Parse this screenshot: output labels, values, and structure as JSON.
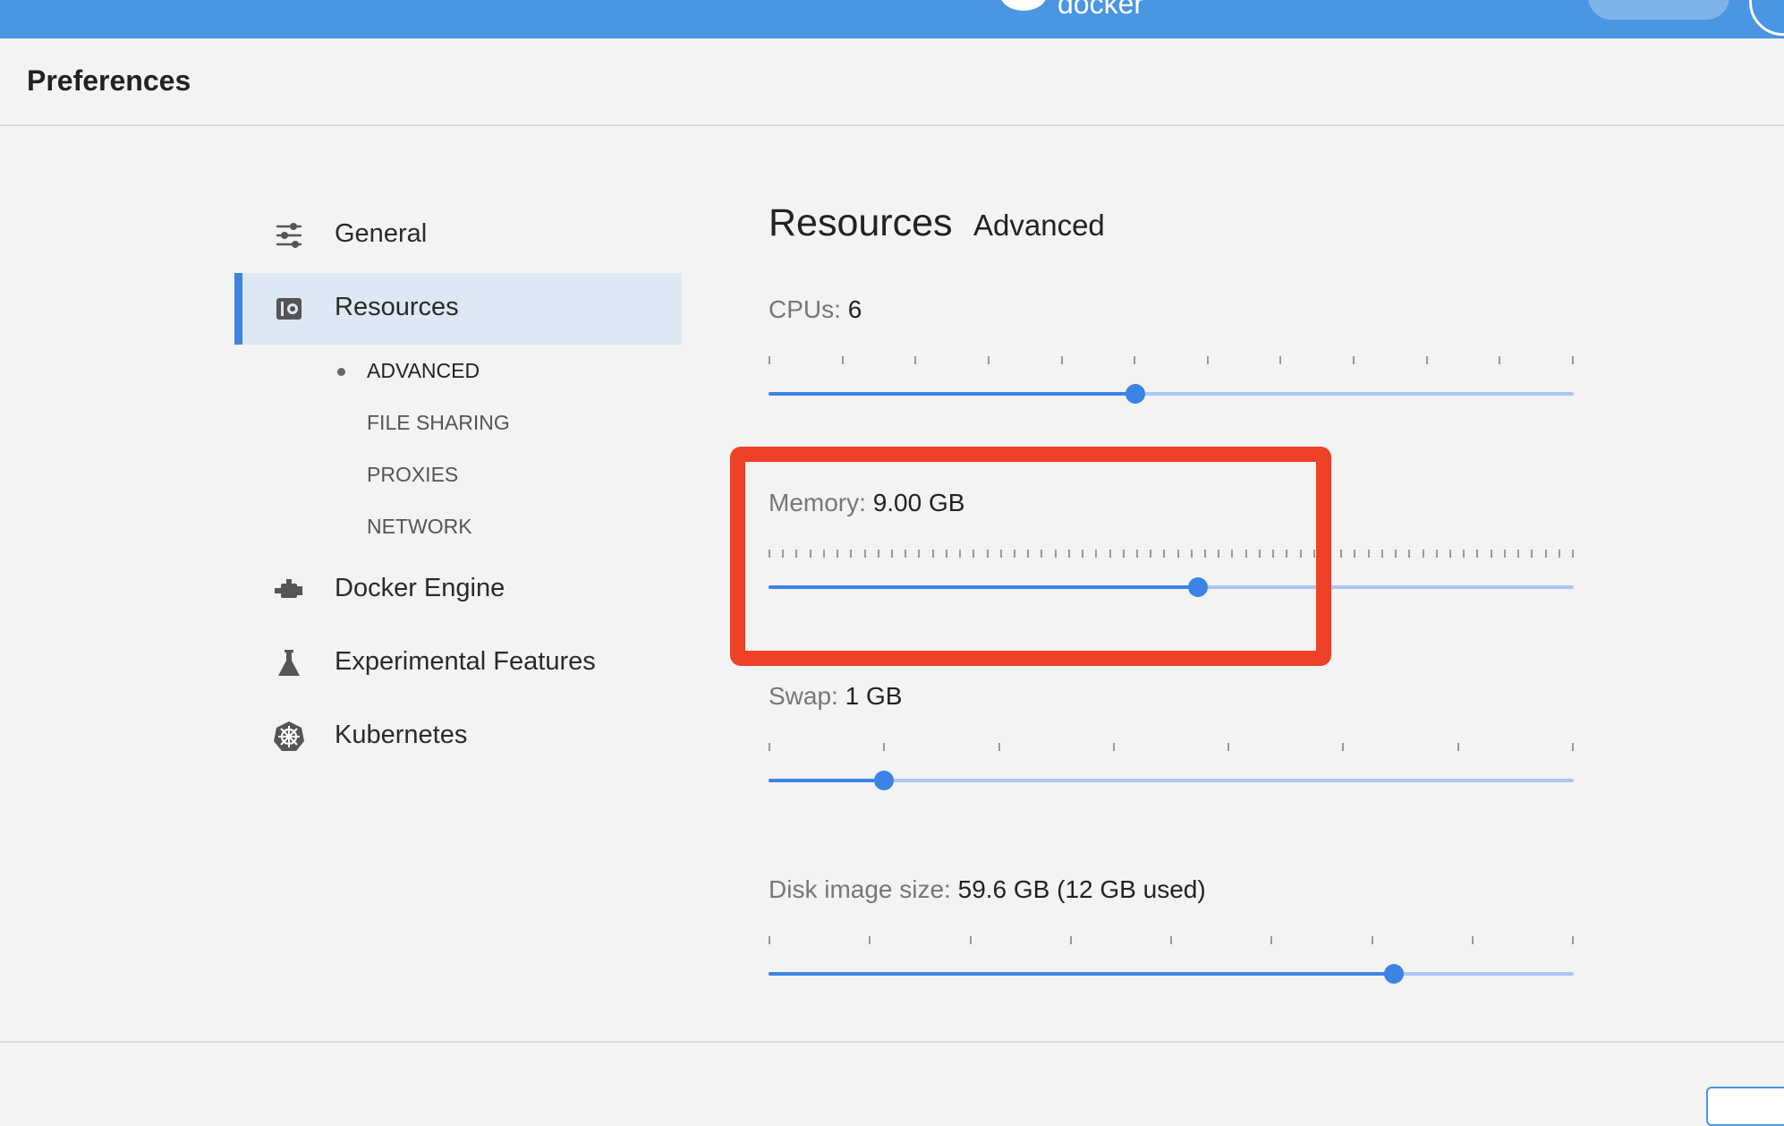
{
  "topbar": {
    "logo_text": "docker",
    "accent_color": "#4a96e3"
  },
  "window": {
    "title": "Preferences"
  },
  "sidebar": {
    "items": [
      {
        "label": "General",
        "icon": "sliders-icon"
      },
      {
        "label": "Resources",
        "icon": "resources-icon",
        "active": true
      },
      {
        "label": "Docker Engine",
        "icon": "engine-icon"
      },
      {
        "label": "Experimental Features",
        "icon": "flask-icon"
      },
      {
        "label": "Kubernetes",
        "icon": "kubernetes-icon"
      }
    ],
    "subitems": [
      {
        "label": "ADVANCED",
        "current": true
      },
      {
        "label": "FILE SHARING"
      },
      {
        "label": "PROXIES"
      },
      {
        "label": "NETWORK"
      }
    ]
  },
  "main": {
    "heading": "Resources",
    "subheading": "Advanced",
    "settings": {
      "cpus": {
        "label": "CPUs:",
        "value": "6",
        "ticks": 12,
        "fraction": 0.455
      },
      "memory": {
        "label": "Memory:",
        "value": "9.00 GB",
        "ticks": 60,
        "fraction": 0.533
      },
      "swap": {
        "label": "Swap:",
        "value": "1 GB",
        "ticks": 8,
        "fraction": 0.143
      },
      "disk": {
        "label": "Disk image size:",
        "value": "59.6 GB (12 GB used)",
        "ticks": 9,
        "fraction": 0.777
      }
    }
  },
  "annotation": {
    "highlight_color": "#ee4126"
  }
}
